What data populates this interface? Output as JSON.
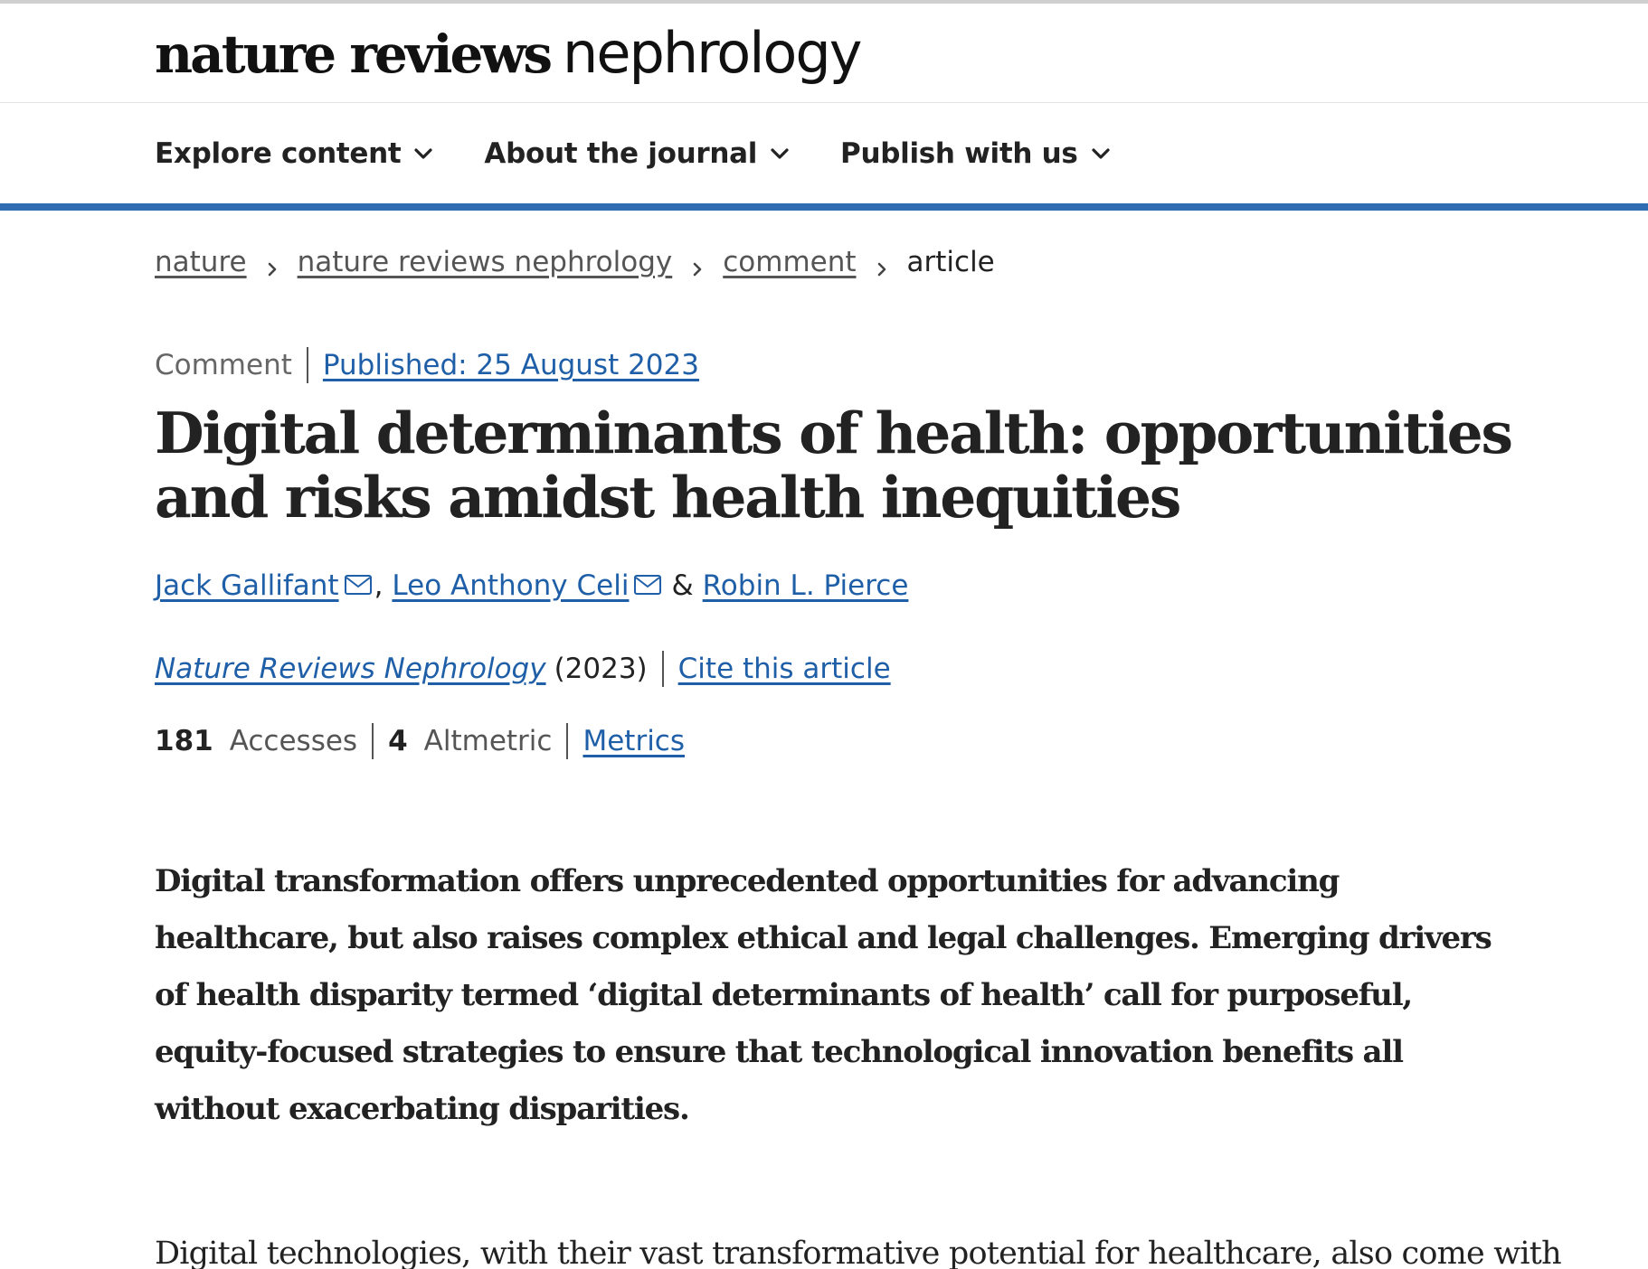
{
  "masthead": {
    "logo_bold": "nature reviews",
    "logo_light": "nephrology"
  },
  "nav": {
    "items": [
      {
        "label": "Explore content",
        "icon": "chevron-down-icon"
      },
      {
        "label": "About the journal",
        "icon": "chevron-down-icon"
      },
      {
        "label": "Publish with us",
        "icon": "chevron-down-icon"
      }
    ]
  },
  "breadcrumb": {
    "items": [
      {
        "label": "nature"
      },
      {
        "label": "nature reviews nephrology"
      },
      {
        "label": "comment"
      }
    ],
    "current": "article",
    "separator_icon": "chevron-right-icon"
  },
  "article": {
    "type": "Comment",
    "published": "Published: 25 August 2023",
    "title": "Digital determinants of health: opportunities and risks amidst health inequities",
    "authors": [
      {
        "name": "Jack Gallifant",
        "has_email": true
      },
      {
        "name": "Leo Anthony Celi",
        "has_email": true
      },
      {
        "name": "Robin L. Pierce",
        "has_email": false
      }
    ],
    "author_comma": ",",
    "author_amp": "&",
    "journal": "Nature Reviews Nephrology",
    "year": "(2023)",
    "cite_label": "Cite this article",
    "metrics": {
      "accesses_count": "181",
      "accesses_label": "Accesses",
      "altmetric_count": "4",
      "altmetric_label": "Altmetric",
      "metrics_link": "Metrics"
    },
    "standfirst": "Digital transformation offers unprecedented opportunities for advancing healthcare, but also raises complex ethical and legal challenges. Emerging drivers of health disparity termed ‘digital determinants of health’ call for purposeful, equity-focused strategies to ensure that technological innovation benefits all without exacerbating disparities.",
    "body_first_line": "Digital technologies, with their vast transformative potential for healthcare, also come with"
  },
  "colors": {
    "accent": "#2f6cb2",
    "link": "#1f5fa8",
    "text": "#222222",
    "muted": "#555555"
  }
}
